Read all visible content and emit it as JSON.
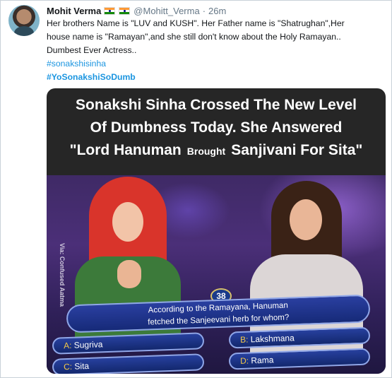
{
  "tweet": {
    "author_name": "Mohit Verma",
    "handle": "@Mohitt_Verma",
    "separator": "·",
    "time": "26m",
    "text_lines": [
      "Her brothers Name is \"LUV and KUSH\". Her Father name is \"Shatrughan\",Her",
      "house name is \"Ramayan\",and she still don't know about the Holy Ramayan..",
      "Dumbest Ever Actress.."
    ],
    "hashtags": [
      "#sonakshisinha",
      "#YoSonakshiSoDumb"
    ]
  },
  "media": {
    "caption_line1": "Sonakshi Sinha Crossed The New Level",
    "caption_line2": "Of Dumbness Today. She Answered",
    "caption_line3_a": "\"Lord Hanuman",
    "caption_line3_b": "Brought",
    "caption_line3_c": "Sanjivani For Sita\"",
    "watermark": "Via: Confused Aatma",
    "timer": "38",
    "question_line1": "According to the Ramayana, Hanuman",
    "question_line2": "fetched the Sanjeevani herb for whom?",
    "options": [
      {
        "key": "A:",
        "text": "Sugriva"
      },
      {
        "key": "B:",
        "text": "Lakshmana"
      },
      {
        "key": "C:",
        "text": "Sita"
      },
      {
        "key": "D:",
        "text": "Rama"
      }
    ]
  },
  "colors": {
    "link": "#1b95e0",
    "secondary_text": "#657786"
  }
}
